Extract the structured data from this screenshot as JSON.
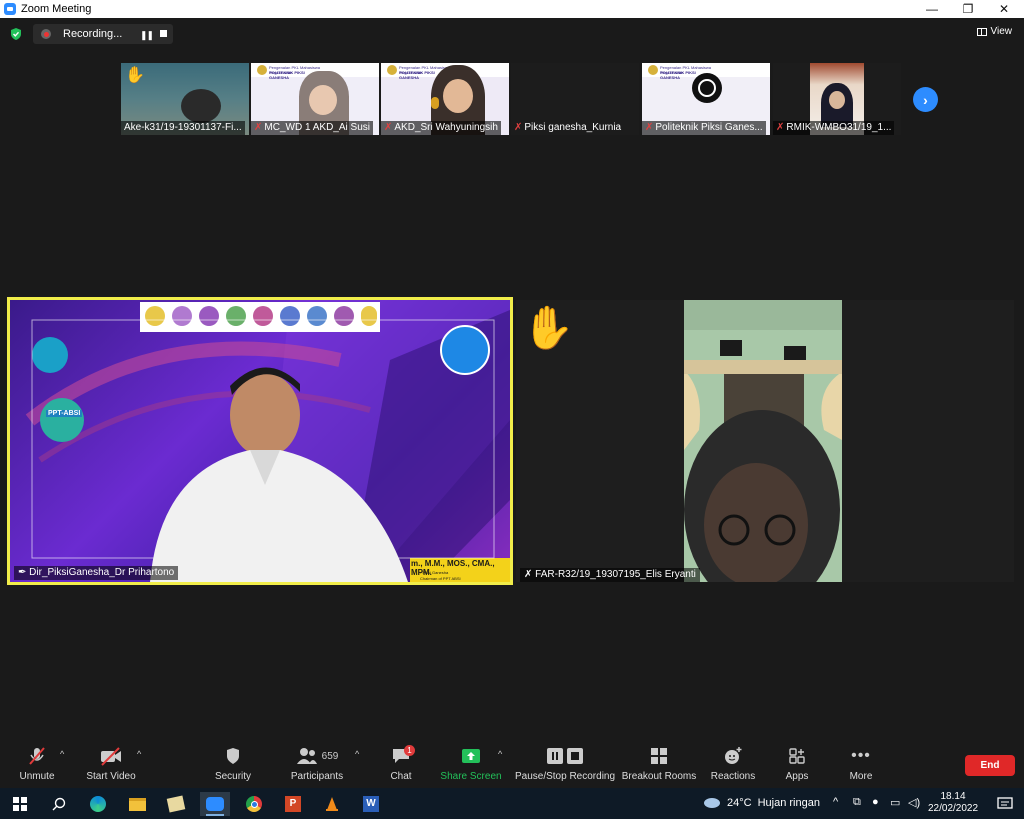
{
  "window": {
    "title": "Zoom Meeting",
    "minimize": "—",
    "restore": "❐",
    "close": "✕"
  },
  "recording": {
    "label": "Recording..."
  },
  "view_button": {
    "label": "View"
  },
  "thumbnails": [
    {
      "name": "Ake-k31/19-19301137-Fi...",
      "muted": false
    },
    {
      "name": "MC_WD 1 AKD_Ai Susi",
      "muted": true
    },
    {
      "name": "AKD_Sri Wahyuningsih",
      "muted": true
    },
    {
      "name": "Piksi ganesha_Kurnia",
      "muted": true
    },
    {
      "name": "Politeknik Piksi Ganes...",
      "muted": true
    },
    {
      "name": "RMIK-WMBO31/19_1...",
      "muted": true
    }
  ],
  "banner_text": {
    "heading": "Pengenalan PKL Mahasiswa Tingkat Akhir",
    "institution": "POLITEKNIK PIKSI GANESHA"
  },
  "main_video": {
    "name": "Dir_PiksiGanesha_Dr Prihartono",
    "ppt_logo_text": "PPT-ABSI",
    "caption_line1": "m., M.M., MOS., CMA., MPM.",
    "caption_line2": "- Piksi Ganesha",
    "caption_line3": "Chairman of PPT ABSI"
  },
  "second_video": {
    "name": "FAR-R32/19_19307195_Elis Eryanti",
    "raised_hand": "✋"
  },
  "toolbar": {
    "unmute": "Unmute",
    "start_video": "Start Video",
    "security": "Security",
    "participants": "Participants",
    "participants_count": "659",
    "chat": "Chat",
    "chat_badge": "1",
    "share_screen": "Share Screen",
    "pause_stop_recording": "Pause/Stop Recording",
    "breakout_rooms": "Breakout Rooms",
    "reactions": "Reactions",
    "apps": "Apps",
    "more": "More",
    "end": "End"
  },
  "taskbar": {
    "weather_temp": "24°C",
    "weather_text": "Hujan ringan",
    "time": "18.14",
    "date": "22/02/2022"
  },
  "colors": {
    "accent": "#2d8cff",
    "active_speaker_border": "#f1ed4a",
    "end_button": "#e02828",
    "share_screen": "#23c05a"
  }
}
